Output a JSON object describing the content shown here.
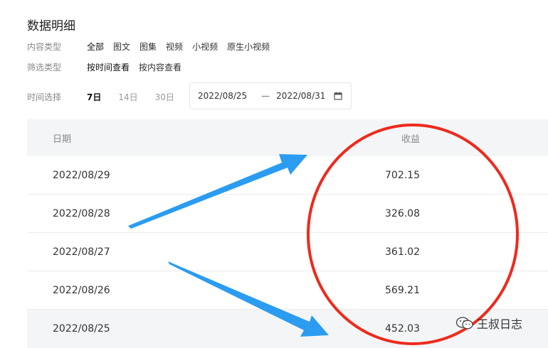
{
  "page": {
    "title": "数据明细"
  },
  "filters": {
    "content_type": {
      "label": "内容类型",
      "options": [
        "全部",
        "图文",
        "图集",
        "视频",
        "小视频",
        "原生小视频"
      ]
    },
    "filter_type": {
      "label": "筛选类型",
      "options": [
        "按时间查看",
        "按内容查看"
      ]
    },
    "time": {
      "label": "时间选择",
      "ranges": [
        "7日",
        "14日",
        "30日"
      ],
      "selected": "7日",
      "start_date": "2022/08/25",
      "separator": "—",
      "end_date": "2022/08/31"
    }
  },
  "table": {
    "headers": {
      "date": "日期",
      "revenue": "收益"
    },
    "rows": [
      {
        "date": "2022/08/29",
        "revenue": "702.15"
      },
      {
        "date": "2022/08/28",
        "revenue": "326.08"
      },
      {
        "date": "2022/08/27",
        "revenue": "361.02"
      },
      {
        "date": "2022/08/26",
        "revenue": "569.21"
      },
      {
        "date": "2022/08/25",
        "revenue": "452.03"
      }
    ]
  },
  "annotations": {
    "arrow_color": "#2b9cf0",
    "circle_color": "#ee2a1c"
  },
  "watermark": {
    "icon": "wechat-icon",
    "text": "王叔日志"
  }
}
